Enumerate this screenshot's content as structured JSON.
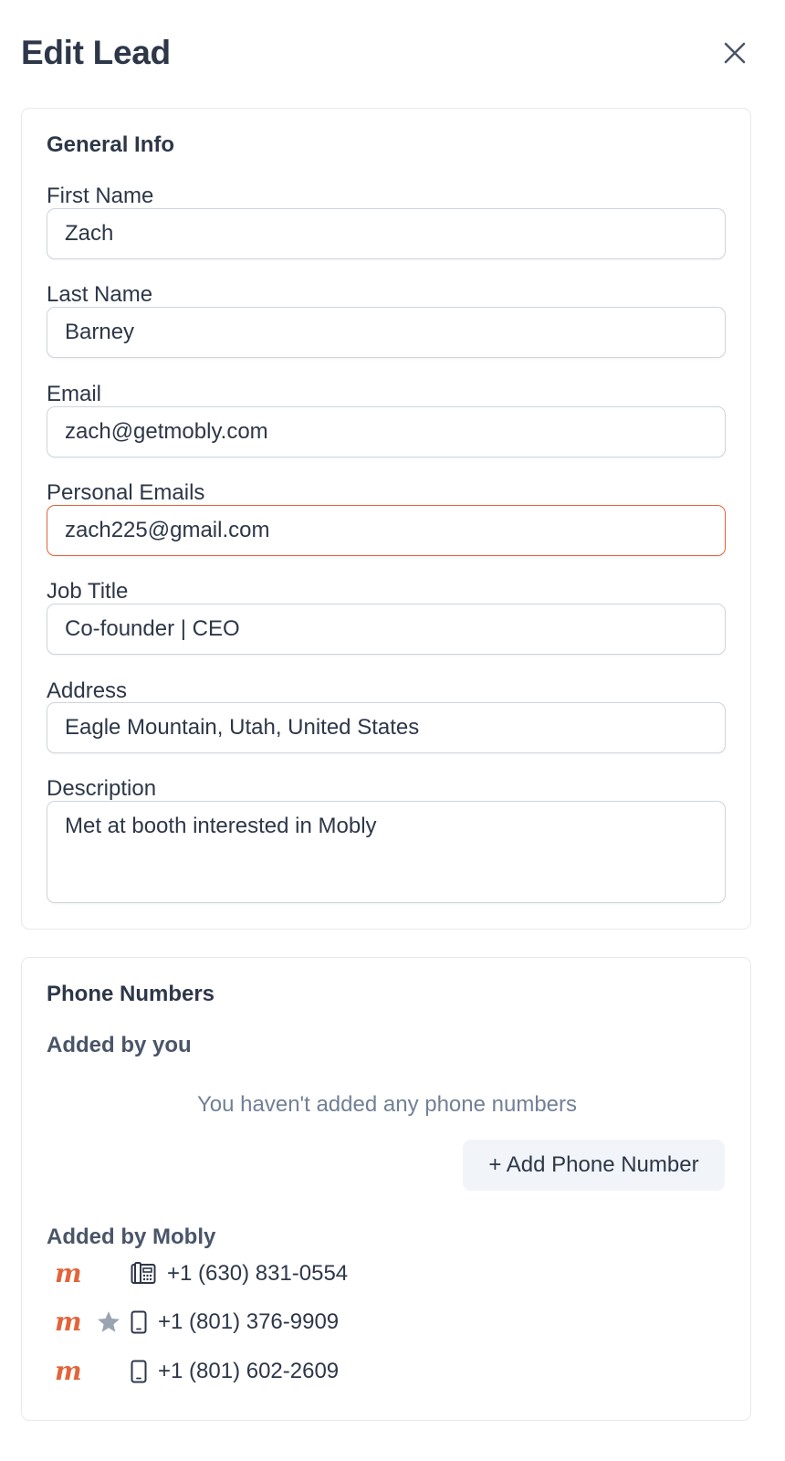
{
  "header": {
    "title": "Edit Lead"
  },
  "general": {
    "section_title": "General Info",
    "fields": {
      "first_name": {
        "label": "First Name",
        "value": "Zach"
      },
      "last_name": {
        "label": "Last Name",
        "value": "Barney"
      },
      "email": {
        "label": "Email",
        "value": "zach@getmobly.com"
      },
      "personal_emails": {
        "label": "Personal Emails",
        "value": "zach225@gmail.com"
      },
      "job_title": {
        "label": "Job Title",
        "value": "Co-founder | CEO"
      },
      "address": {
        "label": "Address",
        "value": "Eagle Mountain, Utah, United States"
      },
      "description": {
        "label": "Description",
        "value": "Met at booth interested in Mobly"
      }
    }
  },
  "phones": {
    "section_title": "Phone Numbers",
    "added_by_you": {
      "heading": "Added by you",
      "empty_text": "You haven't added any phone numbers",
      "add_button_label": "+ Add Phone Number"
    },
    "added_by_mobly": {
      "heading": "Added by Mobly",
      "numbers": [
        {
          "number": "+1 (630) 831-0554",
          "type": "office-phone-icon",
          "starred": false
        },
        {
          "number": "+1 (801) 376-9909",
          "type": "mobile-phone-icon",
          "starred": true
        },
        {
          "number": "+1 (801) 602-2609",
          "type": "mobile-phone-icon",
          "starred": false
        }
      ]
    }
  },
  "colors": {
    "accent": "#e2643a",
    "text": "#2d3748",
    "muted": "#718096",
    "border": "#cfd5dd"
  }
}
